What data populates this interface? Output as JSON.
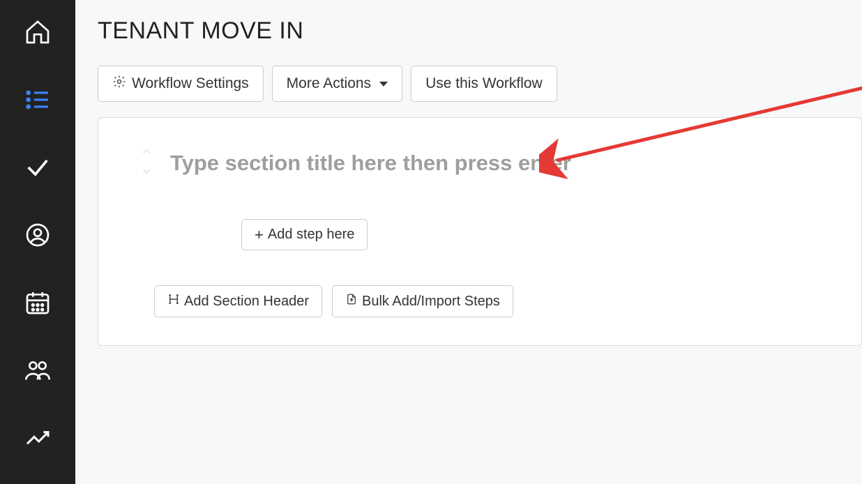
{
  "sidebar": {
    "items": [
      {
        "name": "home"
      },
      {
        "name": "list",
        "active": true
      },
      {
        "name": "check"
      },
      {
        "name": "user"
      },
      {
        "name": "calendar"
      },
      {
        "name": "group"
      },
      {
        "name": "analytics"
      }
    ]
  },
  "header": {
    "title": "TENANT MOVE IN"
  },
  "toolbar": {
    "workflow_settings_label": "Workflow Settings",
    "more_actions_label": "More Actions",
    "use_workflow_label": "Use this Workflow"
  },
  "section": {
    "title_placeholder": "Type section title here then press enter",
    "title_value": ""
  },
  "buttons": {
    "add_step_label": "Add step here",
    "add_section_header_label": "Add Section Header",
    "bulk_import_label": "Bulk Add/Import Steps"
  },
  "annotation": {
    "color": "#e53935"
  }
}
